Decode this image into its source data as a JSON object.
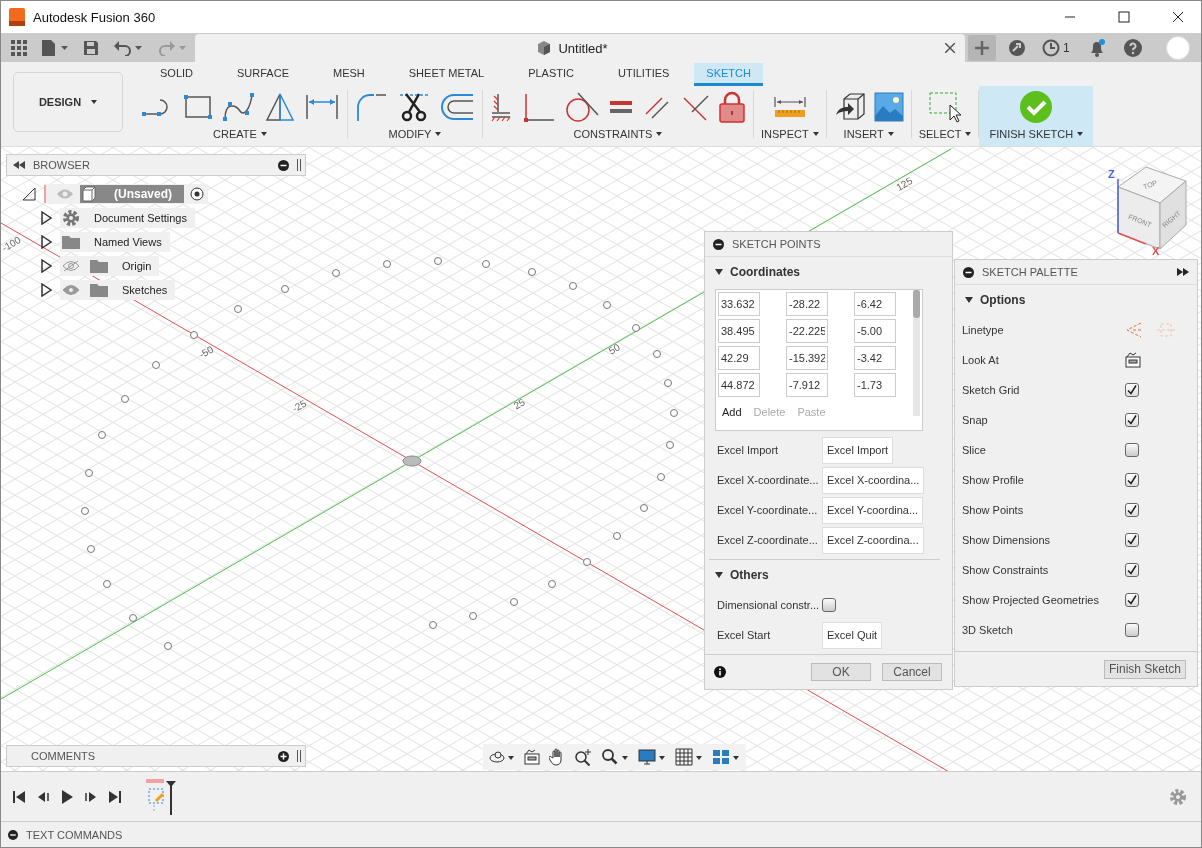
{
  "window": {
    "title": "Autodesk Fusion 360"
  },
  "document_tab": {
    "title": "Untitled*"
  },
  "header": {
    "job_count": "1"
  },
  "workspace": {
    "label": "DESIGN"
  },
  "tabs": [
    {
      "label": "SOLID",
      "selected": false
    },
    {
      "label": "SURFACE",
      "selected": false
    },
    {
      "label": "MESH",
      "selected": false
    },
    {
      "label": "SHEET METAL",
      "selected": false
    },
    {
      "label": "PLASTIC",
      "selected": false
    },
    {
      "label": "UTILITIES",
      "selected": false
    },
    {
      "label": "SKETCH",
      "selected": true
    }
  ],
  "groups": [
    {
      "label": "CREATE",
      "highlighted": false
    },
    {
      "label": "MODIFY",
      "highlighted": false
    },
    {
      "label": "CONSTRAINTS",
      "highlighted": false
    },
    {
      "label": "INSPECT",
      "highlighted": false
    },
    {
      "label": "INSERT",
      "highlighted": false
    },
    {
      "label": "SELECT",
      "highlighted": false
    },
    {
      "label": "FINISH SKETCH",
      "highlighted": true
    }
  ],
  "browser": {
    "title": "BROWSER",
    "root": {
      "label": "(Unsaved)",
      "expanded": true,
      "visible": true,
      "children": [
        {
          "label": "Document Settings",
          "kind": "settings",
          "expanded": false
        },
        {
          "label": "Named Views",
          "kind": "folder",
          "expanded": false
        },
        {
          "label": "Origin",
          "kind": "folder",
          "expanded": false,
          "visible": false
        },
        {
          "label": "Sketches",
          "kind": "folder",
          "expanded": false,
          "visible": true
        }
      ]
    }
  },
  "viewport": {
    "axis_labels": [
      "125",
      "50",
      "25",
      "-25",
      "-50",
      "-100"
    ],
    "viewcube": {
      "top": "TOP",
      "front": "FRONT",
      "right": "RIGHT",
      "z": "Z",
      "x": "X"
    }
  },
  "sketch_points": {
    "title": "SKETCH POINTS",
    "coordinates": {
      "title": "Coordinates",
      "expanded": true,
      "rows": [
        [
          "33.632",
          "-28.22",
          "-6.42"
        ],
        [
          "38.495",
          "-22.225",
          "-5.00"
        ],
        [
          "42.29",
          "-15.392",
          "-3.42"
        ],
        [
          "44.872",
          "-7.912",
          "-1.73"
        ]
      ],
      "actions": [
        {
          "label": "Add",
          "disabled": false
        },
        {
          "label": "Delete",
          "disabled": true
        },
        {
          "label": "Paste",
          "disabled": true
        }
      ]
    },
    "fields": [
      {
        "label": "Excel Import",
        "button": "Excel Import"
      },
      {
        "label": "Excel X-coordinate...",
        "button": "Excel X-coordina..."
      },
      {
        "label": "Excel Y-coordinate...",
        "button": "Excel Y-coordina..."
      },
      {
        "label": "Excel Z-coordinate...",
        "button": "Excel Z-coordina..."
      }
    ],
    "others": {
      "title": "Others",
      "expanded": true,
      "dimensional": {
        "label": "Dimensional constr...",
        "checked": false
      },
      "excel_start": {
        "label": "Excel Start",
        "button": "Excel Quit"
      }
    },
    "ok": "OK",
    "cancel": "Cancel"
  },
  "palette": {
    "title": "SKETCH PALETTE",
    "section": "Options",
    "options": [
      {
        "label": "Linetype",
        "kind": "linetype"
      },
      {
        "label": "Look At",
        "kind": "lookat"
      },
      {
        "label": "Sketch Grid",
        "kind": "check",
        "checked": true
      },
      {
        "label": "Snap",
        "kind": "check",
        "checked": true
      },
      {
        "label": "Slice",
        "kind": "check",
        "checked": false
      },
      {
        "label": "Show Profile",
        "kind": "check",
        "checked": true
      },
      {
        "label": "Show Points",
        "kind": "check",
        "checked": true
      },
      {
        "label": "Show Dimensions",
        "kind": "check",
        "checked": true
      },
      {
        "label": "Show Constraints",
        "kind": "check",
        "checked": true
      },
      {
        "label": "Show Projected Geometries",
        "kind": "check",
        "checked": true
      },
      {
        "label": "3D Sketch",
        "kind": "check",
        "checked": false
      }
    ],
    "finish": "Finish Sketch"
  },
  "comments": {
    "title": "COMMENTS"
  },
  "text_commands": {
    "title": "TEXT COMMANDS"
  }
}
